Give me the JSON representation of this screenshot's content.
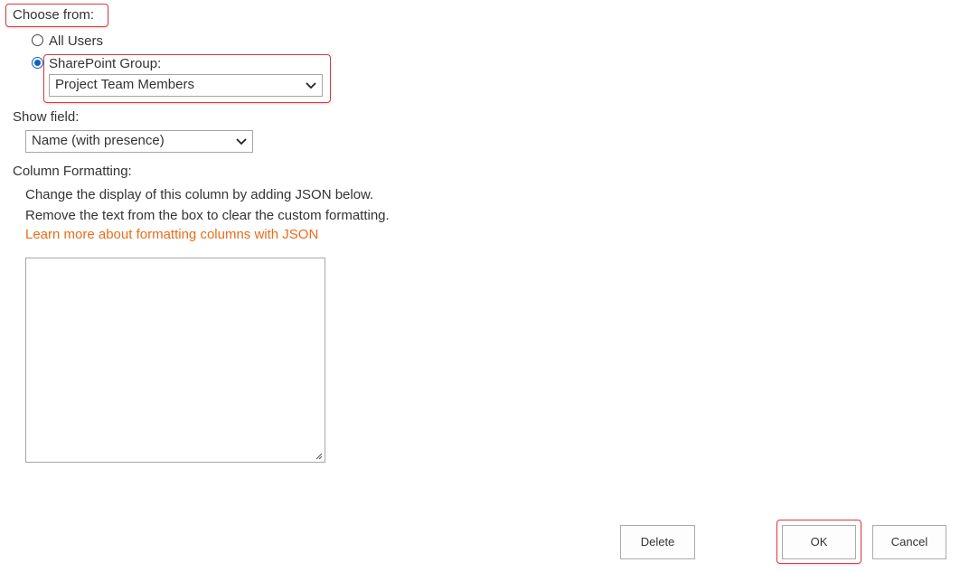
{
  "choose_from": {
    "label": "Choose from:",
    "options": [
      {
        "label": "All Users",
        "selected": false
      },
      {
        "label": "SharePoint Group:",
        "selected": true
      }
    ],
    "group_select": {
      "value": "Project Team Members"
    }
  },
  "show_field": {
    "label": "Show field:",
    "select": {
      "value": "Name (with presence)"
    }
  },
  "column_formatting": {
    "label": "Column Formatting:",
    "description_line1": "Change the display of this column by adding JSON below.",
    "description_line2": "Remove the text from the box to clear the custom formatting.",
    "learn_more_link": "Learn more about formatting columns with JSON",
    "json_value": ""
  },
  "buttons": {
    "delete": "Delete",
    "ok": "OK",
    "cancel": "Cancel"
  },
  "colors": {
    "link": "#ea6c17",
    "highlight": "#d93a3e",
    "radio_selected": "#0b63c7"
  },
  "icons": {
    "select_arrow": "chevron-down-icon",
    "textarea_resize": "resize-grip-icon"
  }
}
